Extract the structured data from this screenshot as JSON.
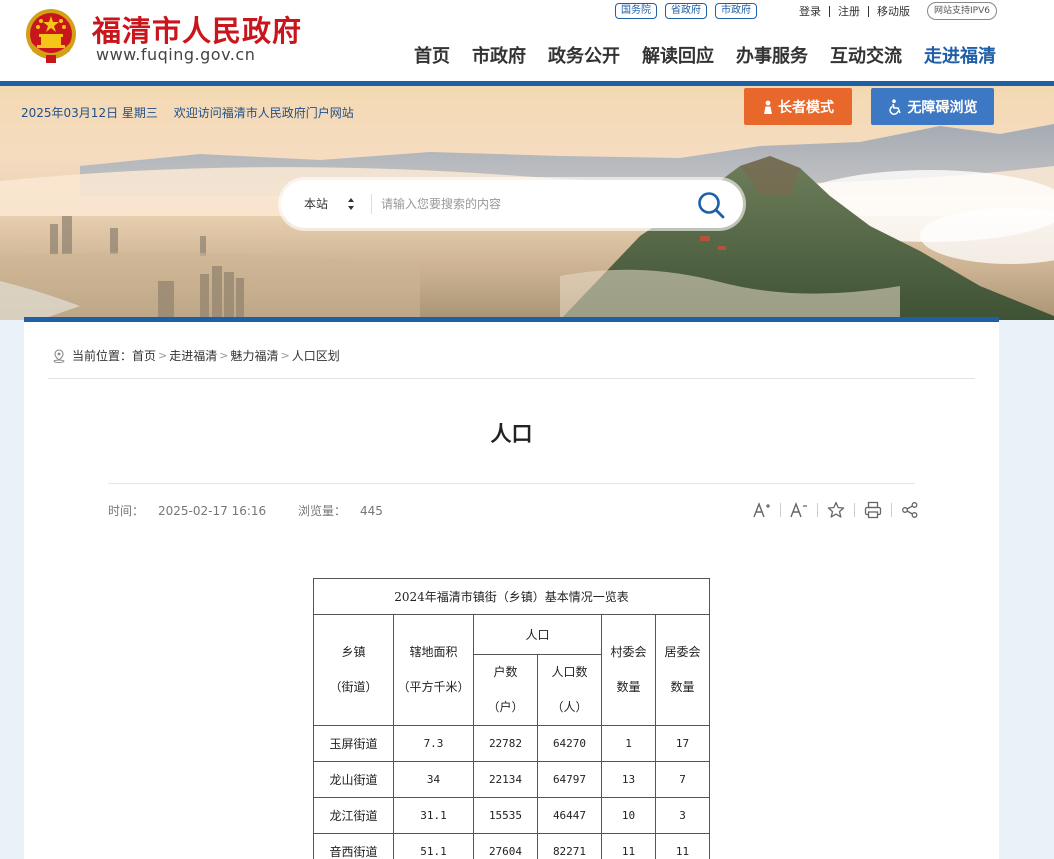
{
  "header": {
    "site_name": "福清市人民政府",
    "site_url": "www.fuqing.gov.cn",
    "gov_links": [
      "国务院",
      "省政府",
      "市政府"
    ],
    "user_links": [
      "登录",
      "注册",
      "移动版"
    ],
    "ipv6_badge": "网站支持IPV6",
    "nav": [
      "首页",
      "市政府",
      "政务公开",
      "解读回应",
      "办事服务",
      "互动交流",
      "走进福清"
    ],
    "active_nav_index": 6,
    "brand_color": "#c9161d",
    "accent_color": "#1f5fa8"
  },
  "banner": {
    "date": "2025年03月12日 星期三",
    "welcome": "欢迎访问福清市人民政府门户网站",
    "elder_mode_label": "长者模式",
    "accessibility_label": "无障碍浏览",
    "elder_color": "#e8672b",
    "access_color": "#3d78c4"
  },
  "search": {
    "scope": "本站",
    "placeholder": "请输入您要搜索的内容"
  },
  "breadcrumb": {
    "prefix": "当前位置：",
    "items": [
      "首页",
      "走进福清",
      "魅力福清",
      "人口区划"
    ],
    "separator": ">"
  },
  "article": {
    "title": "人口",
    "time_label": "时间：",
    "time": "2025-02-17 16:16",
    "views_label": "浏览量：",
    "views": "445",
    "tools": [
      "font-larger-icon",
      "font-smaller-icon",
      "favorite-star-icon",
      "print-icon",
      "share-icon"
    ]
  },
  "table": {
    "caption": "2024年福清市镇街（乡镇）基本情况一览表",
    "headers": {
      "town": "乡镇\n（街道）",
      "area": "辖地面积\n（平方千米）",
      "population_group": "人口",
      "households": "户数\n（户）",
      "persons": "人口数\n（人）",
      "village_committees": "村委会\n数量",
      "resident_committees": "居委会\n数量"
    },
    "rows": [
      [
        "玉屏街道",
        "7.3",
        "22782",
        "64270",
        "1",
        "17"
      ],
      [
        "龙山街道",
        "34",
        "22134",
        "64797",
        "13",
        "7"
      ],
      [
        "龙江街道",
        "31.1",
        "15535",
        "46447",
        "10",
        "3"
      ],
      [
        "音西街道",
        "51.1",
        "27604",
        "82271",
        "11",
        "11"
      ]
    ]
  }
}
